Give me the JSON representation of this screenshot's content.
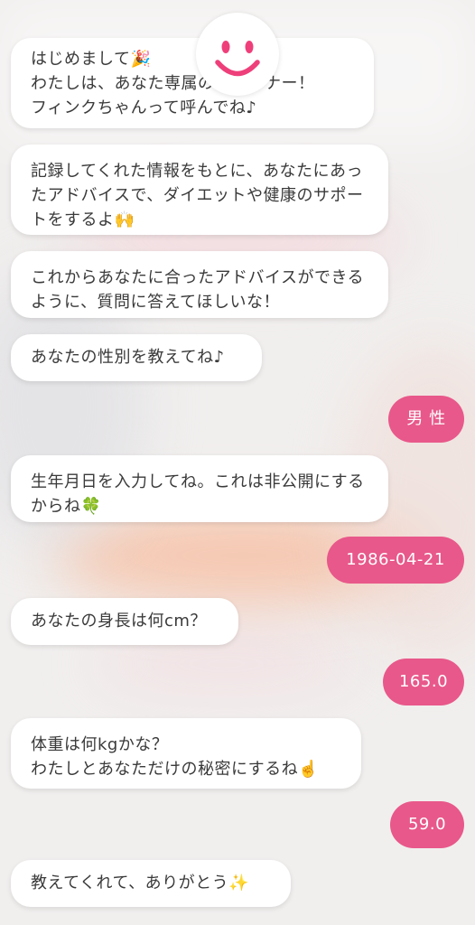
{
  "messages": [
    {
      "text": "はじめまして🎉\nわたしは、あなた専属のトレーナー！\nフィンクちゃんって呼んでね♪"
    },
    {
      "text": "記録してくれた情報をもとに、あなたにあったアドバイスで、ダイエットや健康のサポートをするよ🙌"
    },
    {
      "text": "これからあなたに合ったアドバイスができるように、質問に答えてほしいな！"
    },
    {
      "text": "あなたの性別を教えてね♪"
    },
    {
      "text": "男 性"
    },
    {
      "text": "生年月日を入力してね。これは非公開にするからね🍀"
    },
    {
      "text": "1986-04-21"
    },
    {
      "text": "あなたの身長は何cm？"
    },
    {
      "text": "165.0"
    },
    {
      "text": "体重は何kgかな？\nわたしとあなただけの秘密にするね☝️"
    },
    {
      "text": "59.0"
    },
    {
      "text": "教えてくれて、ありがとう✨"
    }
  ],
  "colors": {
    "user_bubble": "#e8588a",
    "avatar_face": "#ee3f7a"
  },
  "avatar": {
    "icon": "smiley-face-icon"
  }
}
